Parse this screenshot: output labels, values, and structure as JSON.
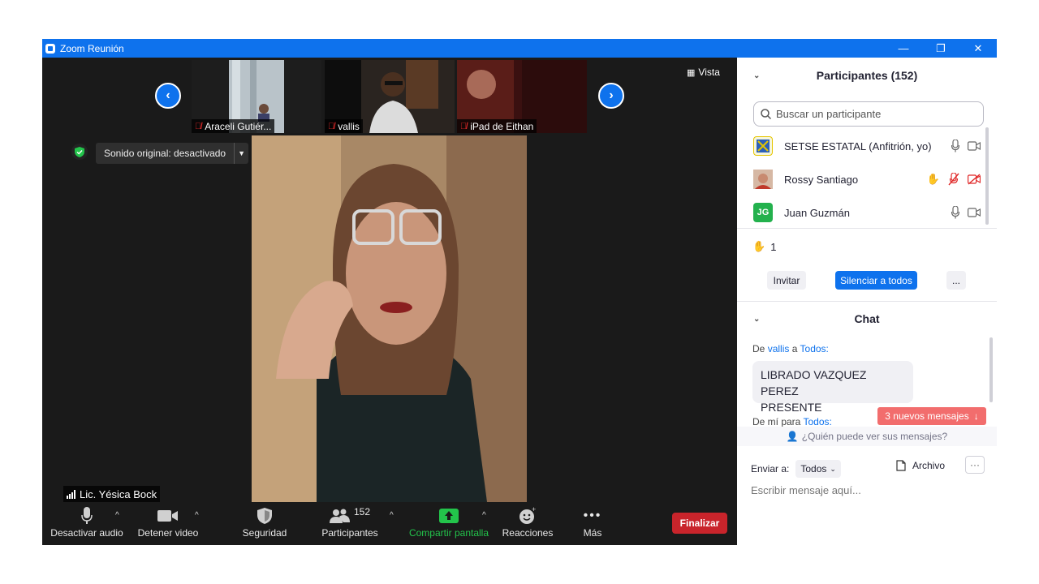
{
  "window": {
    "title": "Zoom Reunión",
    "minimize": "—",
    "restore": "❐",
    "close": "✕"
  },
  "gallery": {
    "prev": "‹",
    "next": "›",
    "thumbs": [
      {
        "name": "Araceli Gutiér..."
      },
      {
        "name": "vallis"
      },
      {
        "name": "iPad de Eithan"
      }
    ],
    "view_label": "Vista"
  },
  "sound": {
    "label": "Sonido original: desactivado"
  },
  "speaker": {
    "name": "Lic. Yésica Bock"
  },
  "toolbar": {
    "audio": "Desactivar audio",
    "video": "Detener video",
    "security": "Seguridad",
    "participants": "Participantes",
    "participants_count": "152",
    "share": "Compartir pantalla",
    "reactions": "Reacciones",
    "more": "Más",
    "end": "Finalizar"
  },
  "participants_panel": {
    "title": "Participantes (152)",
    "search_placeholder": "Buscar un participante",
    "rows": [
      {
        "name": "SETSE ESTATAL (Anfitrión, yo)"
      },
      {
        "name": "Rossy Santiago"
      },
      {
        "name": "Juan Guzmán",
        "initials": "JG"
      }
    ],
    "raised_hands": "1",
    "invite": "Invitar",
    "mute_all": "Silenciar a todos",
    "more": "..."
  },
  "chat": {
    "title": "Chat",
    "msg1_prefix": "De",
    "msg1_from": "vallis",
    "msg1_to_word": "a",
    "msg1_to": "Todos:",
    "msg1_text_line1": "LIBRADO VAZQUEZ PEREZ",
    "msg1_text_line2": "PRESENTE",
    "msg2_prefix": "De mí para",
    "msg2_to": "Todos:",
    "new_messages": "3 nuevos mensajes",
    "who_can_see": "¿Quién puede ver sus mensajes?",
    "send_to_label": "Enviar a:",
    "send_to_value": "Todos",
    "file": "Archivo",
    "more": "···",
    "input_placeholder": "Escribir mensaje aquí..."
  },
  "colors": {
    "accent": "#0e72ed",
    "end": "#c9242b",
    "share": "#23c44b",
    "new_msgs": "#f26d6d"
  }
}
